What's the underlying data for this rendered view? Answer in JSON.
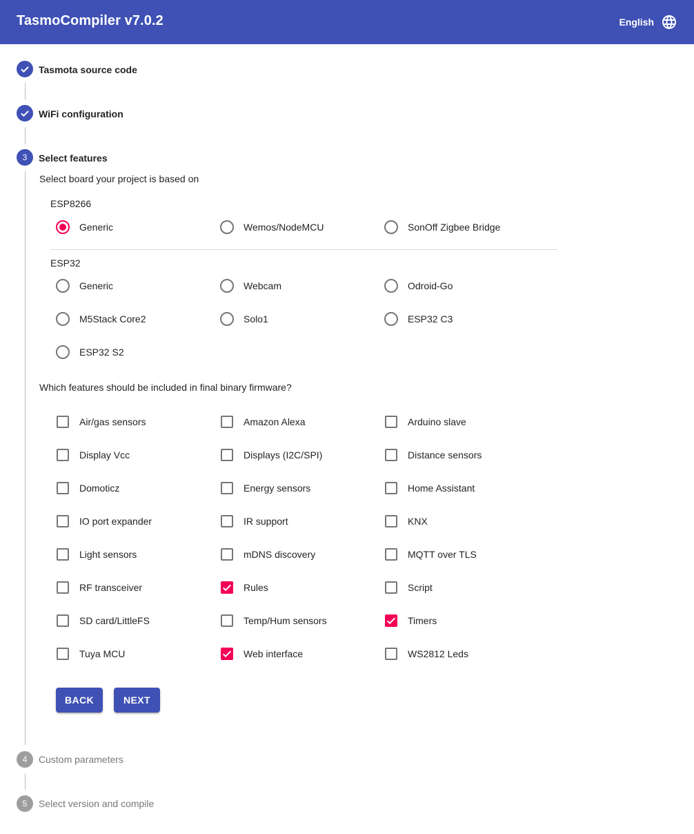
{
  "app": {
    "title": "TasmoCompiler v7.0.2",
    "language": "English",
    "language_icon": "globe-icon",
    "colors": {
      "primary": "#3f51b5",
      "accent": "#f50057",
      "inactive_step": "#9e9e9e"
    }
  },
  "steps": [
    {
      "number": "1",
      "label": "Tasmota source code",
      "state": "completed",
      "icon": "check-icon"
    },
    {
      "number": "2",
      "label": "WiFi configuration",
      "state": "completed",
      "icon": "check-icon"
    },
    {
      "number": "3",
      "label": "Select features",
      "state": "active"
    },
    {
      "number": "4",
      "label": "Custom parameters",
      "state": "pending"
    },
    {
      "number": "5",
      "label": "Select version and compile",
      "state": "pending"
    }
  ],
  "boards": {
    "prompt": "Select board your project is based on",
    "esp8266": {
      "label": "ESP8266",
      "options": [
        {
          "label": "Generic",
          "selected": true
        },
        {
          "label": "Wemos/NodeMCU",
          "selected": false
        },
        {
          "label": "SonOff Zigbee Bridge",
          "selected": false
        }
      ]
    },
    "esp32": {
      "label": "ESP32",
      "options": [
        {
          "label": "Generic",
          "selected": false
        },
        {
          "label": "Webcam",
          "selected": false
        },
        {
          "label": "Odroid-Go",
          "selected": false
        },
        {
          "label": "M5Stack Core2",
          "selected": false
        },
        {
          "label": "Solo1",
          "selected": false
        },
        {
          "label": "ESP32 C3",
          "selected": false
        },
        {
          "label": "ESP32 S2",
          "selected": false
        }
      ]
    }
  },
  "features": {
    "prompt": "Which features should be included in final binary firmware?",
    "items": [
      {
        "label": "Air/gas sensors",
        "checked": false
      },
      {
        "label": "Amazon Alexa",
        "checked": false
      },
      {
        "label": "Arduino slave",
        "checked": false
      },
      {
        "label": "Display Vcc",
        "checked": false
      },
      {
        "label": "Displays (I2C/SPI)",
        "checked": false
      },
      {
        "label": "Distance sensors",
        "checked": false
      },
      {
        "label": "Domoticz",
        "checked": false
      },
      {
        "label": "Energy sensors",
        "checked": false
      },
      {
        "label": "Home Assistant",
        "checked": false
      },
      {
        "label": "IO port expander",
        "checked": false
      },
      {
        "label": "IR support",
        "checked": false
      },
      {
        "label": "KNX",
        "checked": false
      },
      {
        "label": "Light sensors",
        "checked": false
      },
      {
        "label": "mDNS discovery",
        "checked": false
      },
      {
        "label": "MQTT over TLS",
        "checked": false
      },
      {
        "label": "RF transceiver",
        "checked": false
      },
      {
        "label": "Rules",
        "checked": true
      },
      {
        "label": "Script",
        "checked": false
      },
      {
        "label": "SD card/LittleFS",
        "checked": false
      },
      {
        "label": "Temp/Hum sensors",
        "checked": false
      },
      {
        "label": "Timers",
        "checked": true
      },
      {
        "label": "Tuya MCU",
        "checked": false
      },
      {
        "label": "Web interface",
        "checked": true
      },
      {
        "label": "WS2812 Leds",
        "checked": false
      }
    ]
  },
  "actions": {
    "back": "BACK",
    "next": "NEXT"
  }
}
